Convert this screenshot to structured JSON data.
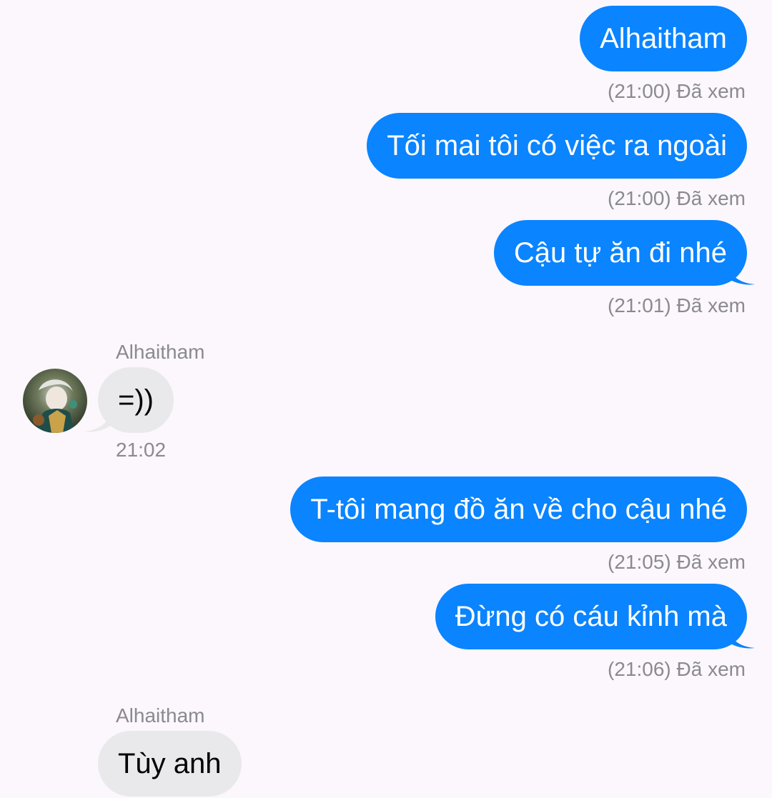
{
  "conversation": {
    "contact_name": "Alhaitham",
    "messages": [
      {
        "direction": "sent",
        "text": "Alhaitham",
        "meta": "(21:00) Đã xem"
      },
      {
        "direction": "sent",
        "text": "Tối mai tôi có việc ra ngoài",
        "meta": "(21:00) Đã xem"
      },
      {
        "direction": "sent",
        "text": "Cậu tự ăn đi nhé",
        "meta": "(21:01) Đã xem"
      },
      {
        "direction": "received",
        "sender": "Alhaitham",
        "text": "=))",
        "meta": "21:02"
      },
      {
        "direction": "sent",
        "text": "T-tôi mang đồ ăn về cho cậu nhé",
        "meta": "(21:05) Đã xem"
      },
      {
        "direction": "sent",
        "text": "Đừng có cáu kỉnh mà",
        "meta": "(21:06) Đã xem"
      },
      {
        "direction": "received",
        "sender": "Alhaitham",
        "text": "Tùy anh",
        "meta": ""
      }
    ]
  },
  "theme": {
    "sent_bubble_color": "#0a84ff",
    "received_bubble_color": "#e9e9eb",
    "background_color": "#fcf7fc",
    "meta_text_color": "#8a8a8f"
  },
  "icons": {
    "avatar": "contact-avatar-image"
  }
}
